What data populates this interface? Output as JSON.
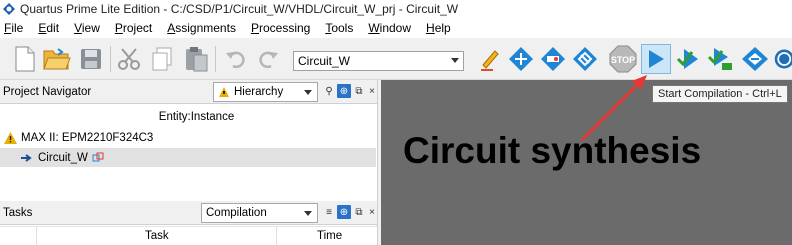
{
  "window": {
    "title": "Quartus Prime Lite Edition - C:/CSD/P1/Circuit_W/VHDL/Circuit_W_prj - Circuit_W"
  },
  "menu": [
    {
      "label": "File",
      "mnemonic": "F",
      "rest": "ile"
    },
    {
      "label": "Edit",
      "mnemonic": "E",
      "rest": "dit"
    },
    {
      "label": "View",
      "mnemonic": "V",
      "rest": "iew"
    },
    {
      "label": "Project",
      "mnemonic": "P",
      "rest": "roject"
    },
    {
      "label": "Assignments",
      "mnemonic": "A",
      "rest": "ssignments"
    },
    {
      "label": "Processing",
      "mnemonic": "P",
      "rest": "rocessing"
    },
    {
      "label": "Tools",
      "mnemonic": "T",
      "rest": "ools"
    },
    {
      "label": "Window",
      "mnemonic": "W",
      "rest": "indow"
    },
    {
      "label": "Help",
      "mnemonic": "H",
      "rest": "elp"
    }
  ],
  "toolbar": {
    "entity_combo": "Circuit_W",
    "stop_label": "STOP"
  },
  "project_navigator": {
    "title": "Project Navigator",
    "view_select": "Hierarchy",
    "column_header": "Entity:Instance",
    "device": "MAX II: EPM2210F324C3",
    "top_entity": "Circuit_W"
  },
  "tasks": {
    "title": "Tasks",
    "flow_select": "Compilation",
    "col_task": "Task",
    "col_time": "Time"
  },
  "tooltip": "Start Compilation - Ctrl+L",
  "annotation": "Circuit synthesis",
  "colors": {
    "annotation_arrow": "#e53935",
    "workspace": "#6b6b6b",
    "toolbar_icon_blue": "#1f86d6"
  }
}
